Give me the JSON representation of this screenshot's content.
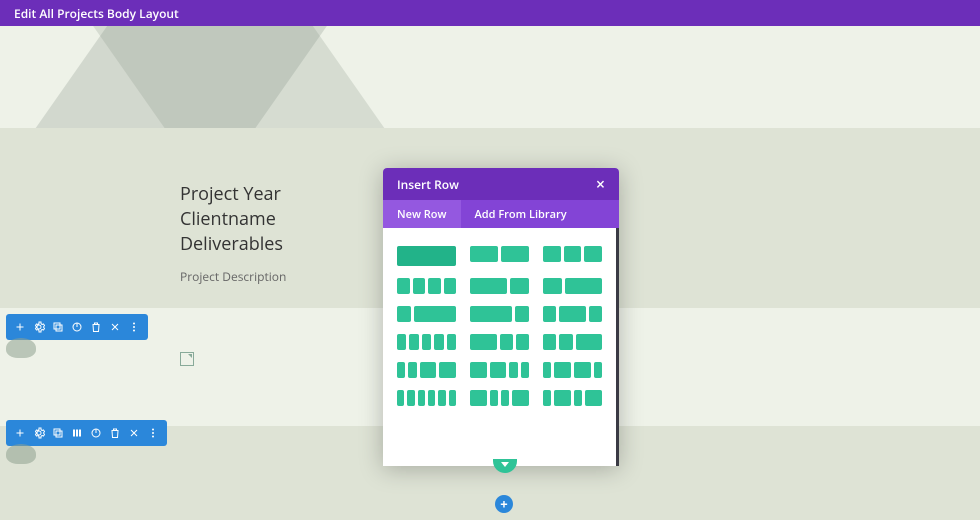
{
  "topbar": {
    "title": "Edit All Projects Body Layout"
  },
  "content": {
    "project_year": "Project Year",
    "clientname": "Clientname",
    "deliverables": "Deliverables",
    "description": "Project Description"
  },
  "toolbar": {
    "icons": [
      "add-icon",
      "gear-icon",
      "duplicate-icon",
      "power-icon",
      "trash-icon",
      "close-icon",
      "more-icon"
    ],
    "icons2": [
      "add-icon",
      "gear-icon",
      "duplicate-icon",
      "columns-icon",
      "power-icon",
      "trash-icon",
      "close-icon",
      "more-icon"
    ]
  },
  "modal": {
    "title": "Insert Row",
    "tabs": {
      "new_row": "New Row",
      "add_from_library": "Add From Library"
    },
    "active_tab": "new_row",
    "layouts": [
      [
        1
      ],
      [
        1,
        1
      ],
      [
        1,
        1,
        1
      ],
      [
        1,
        1,
        1,
        1
      ],
      [
        2,
        1
      ],
      [
        1,
        2
      ],
      [
        1,
        3
      ],
      [
        3,
        1
      ],
      [
        1,
        2,
        1
      ],
      [
        1,
        1,
        1,
        1,
        1
      ],
      [
        2,
        1,
        1
      ],
      [
        1,
        1,
        2
      ],
      [
        1,
        1,
        2,
        2
      ],
      [
        2,
        2,
        1,
        1
      ],
      [
        1,
        2,
        2,
        1
      ],
      [
        1,
        1,
        1,
        1,
        1,
        1
      ],
      [
        2,
        1,
        1,
        2
      ],
      [
        1,
        2,
        1,
        2
      ]
    ]
  },
  "add_button": {
    "label": "+"
  }
}
